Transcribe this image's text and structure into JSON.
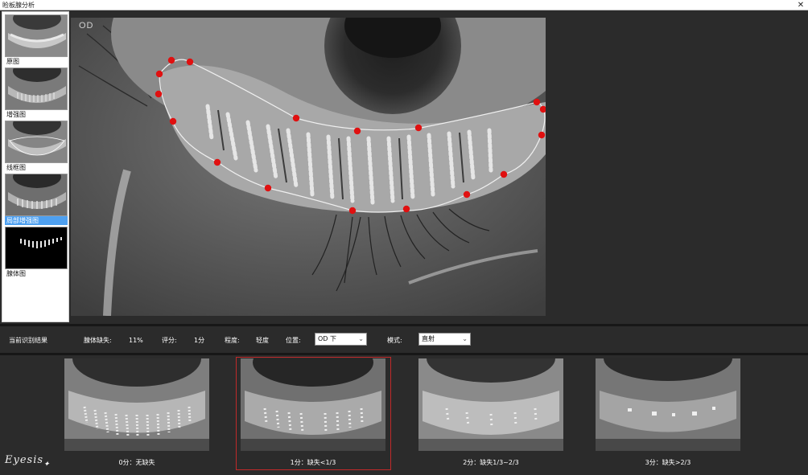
{
  "window": {
    "title": "睑板腺分析",
    "close_glyph": "✕"
  },
  "thumbnails": [
    {
      "label": "原图",
      "selected": false
    },
    {
      "label": "增强图",
      "selected": false
    },
    {
      "label": "线框图",
      "selected": false
    },
    {
      "label": "局部增强图",
      "selected": true
    },
    {
      "label": "腺体图",
      "selected": false
    }
  ],
  "viewer": {
    "eye_label": "OD"
  },
  "result": {
    "heading": "当前识别结果",
    "loss_label": "腺体缺失:",
    "loss_value": "11%",
    "score_label": "评分:",
    "score_value": "1分",
    "degree_label": "程度:",
    "degree_value": "轻度",
    "position_label": "位置:",
    "position_value": "OD 下",
    "mode_label": "模式:",
    "mode_value": "直射"
  },
  "reference": [
    {
      "caption": "0分：无缺失",
      "selected": false
    },
    {
      "caption": "1分：缺失<1/3",
      "selected": true
    },
    {
      "caption": "2分：缺失1/3~2/3",
      "selected": false
    },
    {
      "caption": "3分：缺失>2/3",
      "selected": false
    }
  ],
  "brand": {
    "logo_text": "Eyesis"
  },
  "colors": {
    "marker": "#e01010",
    "selection": "#4ea0f0",
    "ref_border": "#c0292a"
  }
}
